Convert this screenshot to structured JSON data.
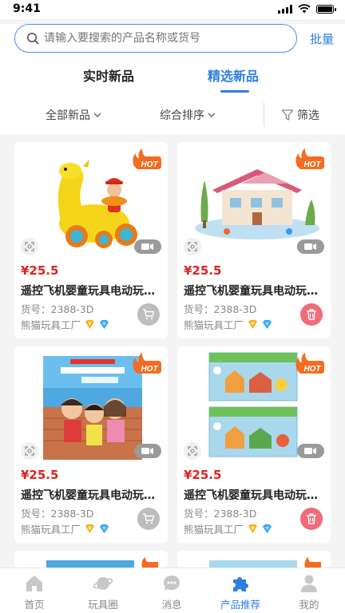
{
  "status_bar": {
    "time": "9:41"
  },
  "search": {
    "placeholder": "请输入要搜索的产品名称或货号",
    "batch_label": "批量"
  },
  "tabs": [
    {
      "label": "实时新品",
      "active": false
    },
    {
      "label": "精选新品",
      "active": true
    }
  ],
  "filters": {
    "category": "全部新品",
    "sort": "综合排序",
    "filter": "筛选"
  },
  "products": [
    {
      "hot": "HOT",
      "price": "¥25.5",
      "title": "遥控飞机婴童玩具电动玩具..",
      "sku": "货号：2388-3D",
      "factory": "熊猫玩具工厂",
      "action": "cart",
      "image": "yellow-giraffe-toy"
    },
    {
      "hot": "HOT",
      "price": "¥25.5",
      "title": "遥控飞机婴童玩具电动玩具..",
      "sku": "货号：2388-3D",
      "factory": "熊猫玩具工厂",
      "action": "delete",
      "image": "dollhouse-toy"
    },
    {
      "hot": "HOT",
      "price": "¥25.5",
      "title": "遥控飞机婴童玩具电动玩具..",
      "sku": "货号：2388-3D",
      "factory": "熊猫玩具工厂",
      "action": "cart",
      "image": "kids-book-cover"
    },
    {
      "hot": "HOT",
      "price": "¥25.5",
      "title": "遥控飞机婴童玩具电动玩具..",
      "sku": "货号：2388-3D",
      "factory": "熊猫玩具工厂",
      "action": "delete",
      "image": "toy-boxes"
    }
  ],
  "tabbar": [
    {
      "label": "首页",
      "icon": "home-icon",
      "active": false
    },
    {
      "label": "玩具圈",
      "icon": "planet-icon",
      "active": false
    },
    {
      "label": "消息",
      "icon": "message-icon",
      "active": false
    },
    {
      "label": "产品推荐",
      "icon": "puzzle-icon",
      "active": true
    },
    {
      "label": "我的",
      "icon": "user-icon",
      "active": false
    }
  ],
  "colors": {
    "accent": "#2f7de1",
    "price": "#e02222",
    "hot": "#f36c21",
    "delete": "#f16b7a"
  }
}
